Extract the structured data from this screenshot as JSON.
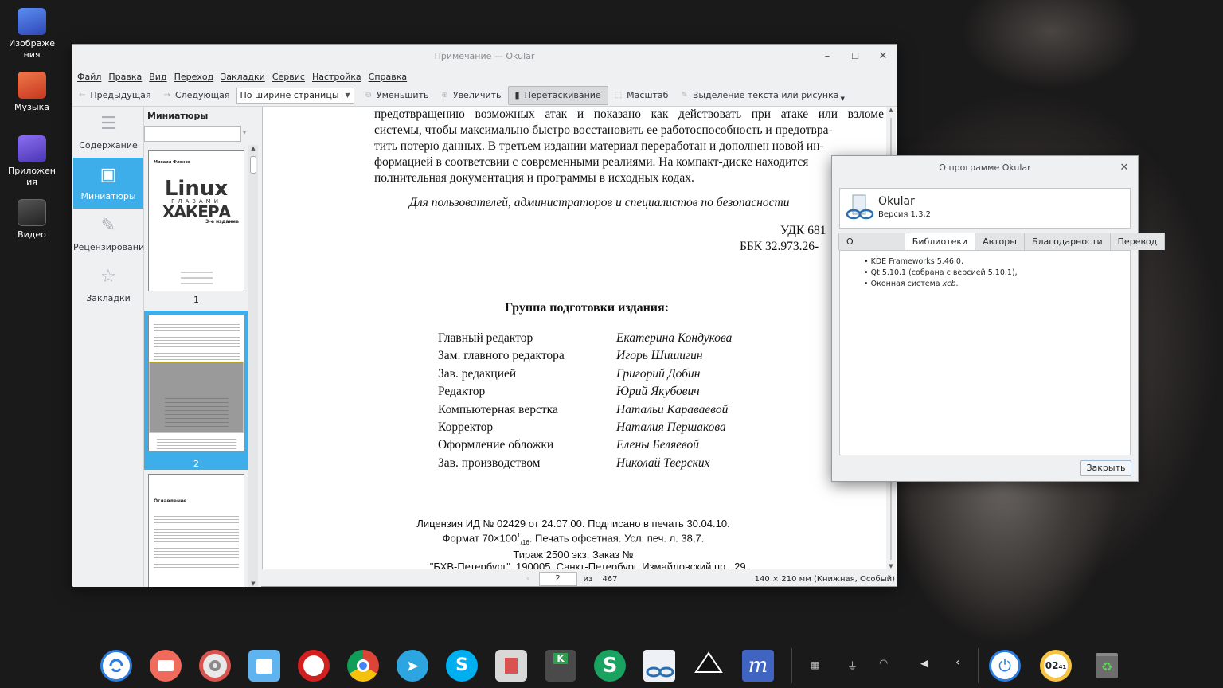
{
  "desktop": {
    "icons": [
      {
        "label": "Изображения",
        "icon": "images-folder-icon",
        "color": "#3b5bd4"
      },
      {
        "label": "Музыка",
        "icon": "music-folder-icon",
        "color": "#e0533a"
      },
      {
        "label": "Приложения",
        "icon": "apps-folder-icon",
        "color": "#6b57d6"
      },
      {
        "label": "Видео",
        "icon": "video-folder-icon",
        "color": "#3a3a3a"
      }
    ]
  },
  "okular": {
    "title": "Примечание  — Okular",
    "menu": [
      "Файл",
      "Правка",
      "Вид",
      "Переход",
      "Закладки",
      "Сервис",
      "Настройка",
      "Справка"
    ],
    "toolbar": {
      "prev": "Предыдущая",
      "next": "Следующая",
      "zoom_mode": "По ширине страницы",
      "zoom_out": "Уменьшить",
      "zoom_in": "Увеличить",
      "drag": "Перетаскивание",
      "scale": "Масштаб",
      "select": "Выделение текста или рисунка"
    },
    "sidebar": {
      "items": [
        {
          "label": "Содержание",
          "icon": "contents-icon"
        },
        {
          "label": "Миниатюры",
          "icon": "thumbnails-icon"
        },
        {
          "label": "Рецензирование",
          "icon": "review-icon"
        },
        {
          "label": "Закладки",
          "icon": "bookmarks-star-icon"
        }
      ]
    },
    "thumbs": {
      "header": "Миниатюры",
      "page1": {
        "author": "Михаил Фленов",
        "title1": "Linux",
        "title2": "ГЛАЗАМИ",
        "title3": "ХАКЕРА",
        "edition": "3-е издание",
        "num": "1"
      },
      "page2": {
        "num": "2"
      },
      "page3": {
        "title": "Оглавление"
      }
    },
    "doc": {
      "para": [
        "предотвращению возможных атак и показано как действовать при атаке или взломе",
        "системы, чтобы максимально быстро восстановить ее работоспособность и предотвра-",
        "тить потерю данных. В третьем издании материал переработан и дополнен новой ин-",
        "формацией в соответсвии с современными реалиями. На компакт-диске находится",
        "полнительная документация и программы в исходных кодах."
      ],
      "audience": "Для пользователей, администраторов и специалистов по безопасности",
      "udk": "УДК 681",
      "bbk": "ББК 32.973.26-",
      "group_title": "Группа подготовки издания:",
      "staff": [
        {
          "role": "Главный редактор",
          "name": "Екатерина Кондукова"
        },
        {
          "role": "Зам. главного редактора",
          "name": "Игорь Шишигин"
        },
        {
          "role": "Зав. редакцией",
          "name": "Григорий Добин"
        },
        {
          "role": "Редактор",
          "name": "Юрий Якубович"
        },
        {
          "role": "Компьютерная верстка",
          "name": "Натальи Караваевой"
        },
        {
          "role": "Корректор",
          "name": "Наталия Першакова"
        },
        {
          "role": "Оформление обложки",
          "name": "Елены Беляевой"
        },
        {
          "role": "Зав. производством",
          "name": "Николай Тверских"
        }
      ],
      "license": "Лицензия ИД № 02429 от 24.07.00. Подписано в печать 30.04.10.",
      "format_a": "Формат 70×100",
      "format_sup": "1",
      "format_sub": "/16",
      "format_b": ".  Печать офсетная. Усл. печ. л. 38,7.",
      "print_run": "Тираж 2500 экз. Заказ №",
      "publisher": "\"БХВ-Петербург\", 190005, Санкт-Петербург, Измайловский пр., 29."
    },
    "status": {
      "page": "2",
      "of": "из",
      "total": "467",
      "page_info": "140 × 210 мм (Книжная, Особый)"
    }
  },
  "about": {
    "title": "О программе Okular",
    "app_name": "Okular",
    "version": "Версия 1.3.2",
    "tabs": [
      "О программе",
      "Библиотеки",
      "Авторы",
      "Благодарности",
      "Перевод"
    ],
    "active_tab": "Библиотеки",
    "libs": [
      "KDE Frameworks 5.46.0,",
      "Qt 5.10.1 (собрана с версией 5.10.1),",
      "Оконная система "
    ],
    "libs_xcb": "xcb",
    "libs_dot": ".",
    "close": "Закрыть"
  },
  "dock": {
    "clock": "02",
    "clock_sub": "41"
  }
}
